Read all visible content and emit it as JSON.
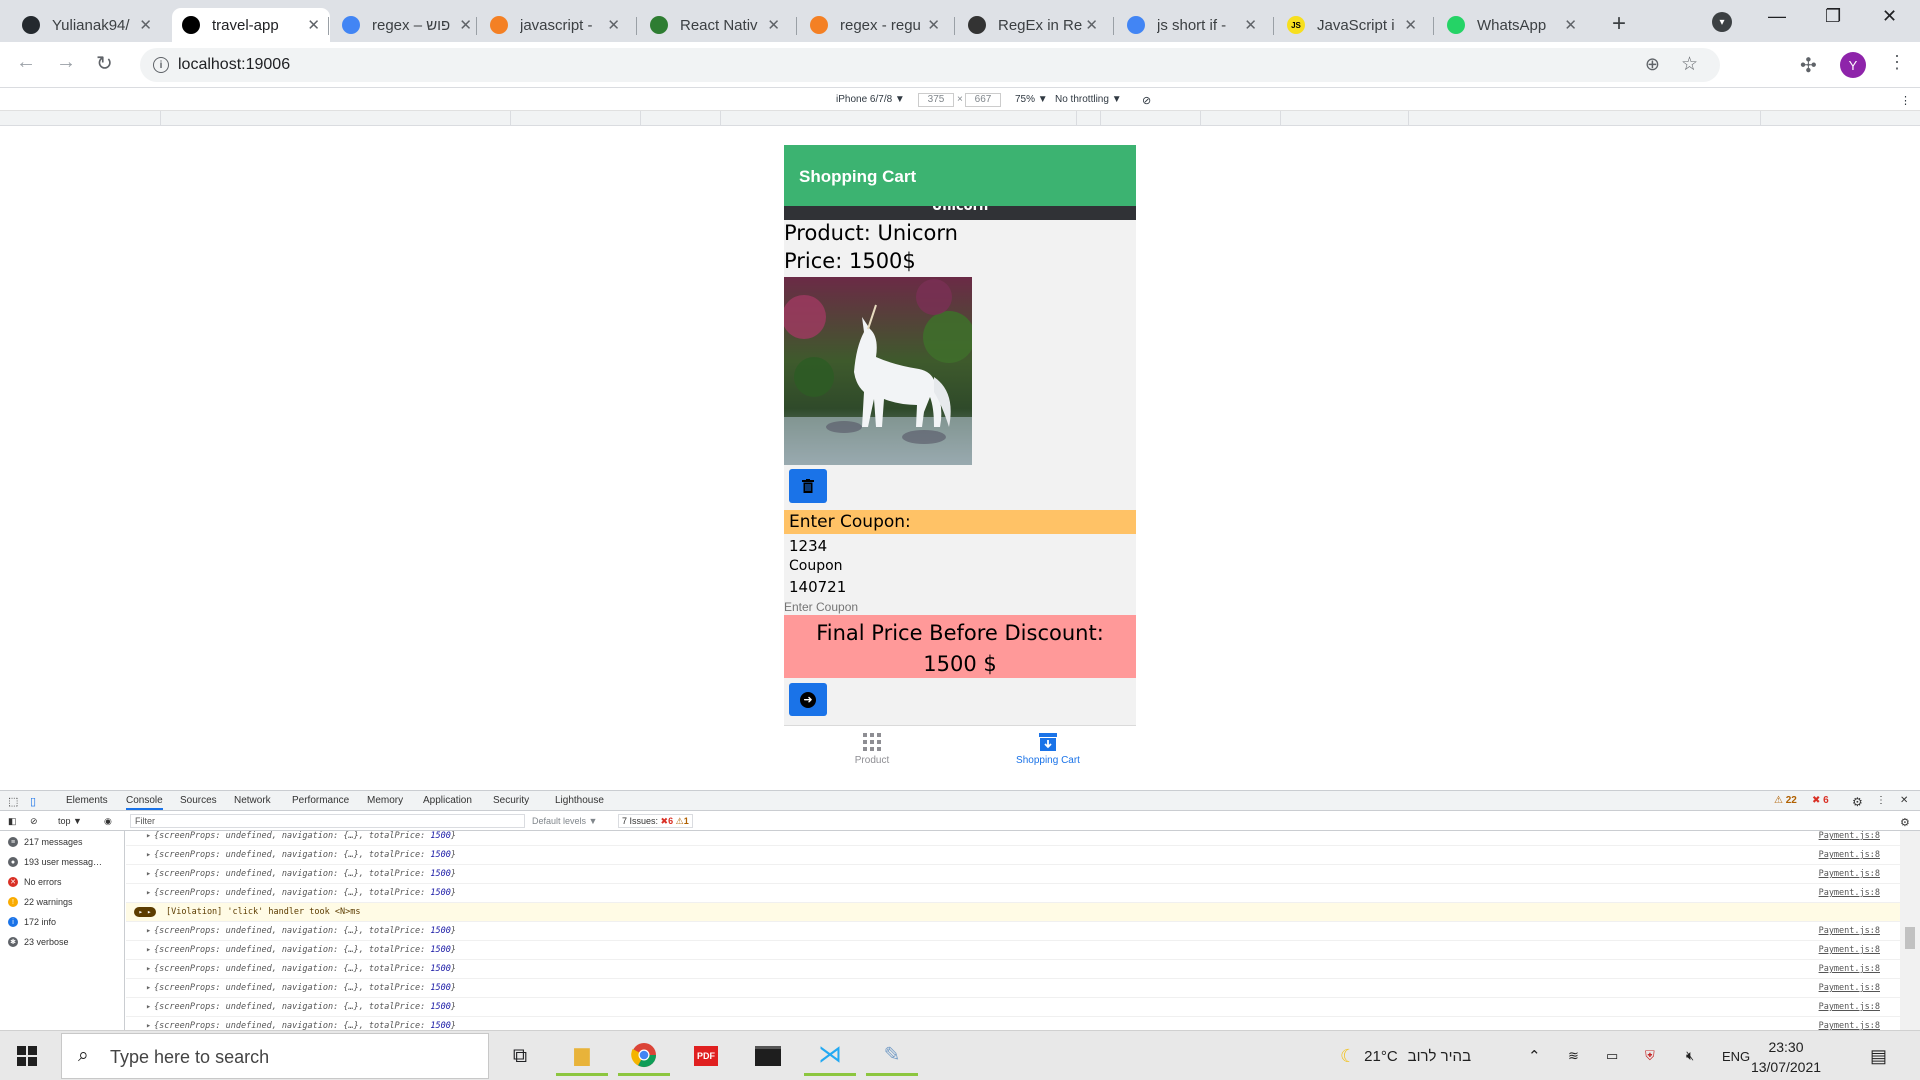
{
  "browser": {
    "tabs": [
      {
        "title": "Yulianak94/",
        "favicon": "github-icon",
        "color": "#24292e"
      },
      {
        "title": "travel-app",
        "favicon": "expo-icon",
        "color": "#000000"
      },
      {
        "title": "regex – פוש",
        "favicon": "google-icon",
        "color": "#4285f4"
      },
      {
        "title": "javascript -",
        "favicon": "stackoverflow-icon",
        "color": "#f48024"
      },
      {
        "title": "React Nativ",
        "favicon": "react-native-icon",
        "color": "#2e7d32"
      },
      {
        "title": "regex - regu",
        "favicon": "stackoverflow-icon",
        "color": "#f48024"
      },
      {
        "title": "RegEx in Re",
        "favicon": "regex-icon",
        "color": "#333333"
      },
      {
        "title": "js short if -",
        "favicon": "google-icon",
        "color": "#4285f4"
      },
      {
        "title": "JavaScript i",
        "favicon": "js-icon",
        "color": "#f7df1e"
      },
      {
        "title": "WhatsApp",
        "favicon": "whatsapp-icon",
        "color": "#25d366"
      }
    ],
    "url": "localhost:19006",
    "profile_initial": "Y"
  },
  "device_toolbar": {
    "device": "iPhone 6/7/8 ▼",
    "width": "375",
    "times": "×",
    "height": "667",
    "zoom": "75% ▼",
    "throttling": "No throttling ▼"
  },
  "app": {
    "header_title": "Shopping Cart",
    "banner_text": "Unicorn",
    "product_line": "Product: Unicorn",
    "price_line": "Price: 1500$",
    "coupon_header": "Enter Coupon:",
    "coupon_code": "1234",
    "coupon_label": "Coupon",
    "coupon_value": "140721",
    "coupon_placeholder": "Enter Coupon",
    "final_title": "Final Price Before Discount:",
    "final_price": "1500 $",
    "tabbar": [
      {
        "label": "Product",
        "icon": "grid-icon",
        "active": false
      },
      {
        "label": "Shopping Cart",
        "icon": "cart-download-icon",
        "active": true
      }
    ],
    "colors": {
      "header": "#3cb371",
      "coupon": "#ffc266",
      "final": "#ff9999",
      "button": "#1a73e8",
      "active_tab": "#1a73e8"
    }
  },
  "devtools": {
    "tabs": [
      "Elements",
      "Console",
      "Sources",
      "Network",
      "Performance",
      "Memory",
      "Application",
      "Security",
      "Lighthouse"
    ],
    "active_tab": "Console",
    "warnings_count": "22",
    "errors_count": "6",
    "context": "top ▼",
    "filter_placeholder": "Filter",
    "levels": "Default levels ▼",
    "issues_label": "7 Issues:",
    "issues_errors": "6",
    "issues_warnings": "1",
    "sidebar": [
      {
        "label": "217 messages",
        "icon": "list-icon",
        "color": "#5f6368"
      },
      {
        "label": "193 user messag…",
        "icon": "user-icon",
        "color": "#5f6368"
      },
      {
        "label": "No errors",
        "icon": "error-icon",
        "color": "#d93025"
      },
      {
        "label": "22 warnings",
        "icon": "warning-icon",
        "color": "#f9ab00"
      },
      {
        "label": "172 info",
        "icon": "info-icon",
        "color": "#1a73e8"
      },
      {
        "label": "23 verbose",
        "icon": "bug-icon",
        "color": "#5f6368"
      }
    ],
    "log_prefix": "{screenProps: undefined, navigation: {…}, totalPrice: ",
    "log_value": "1500",
    "log_suffix": "}",
    "log_source": "Payment.js:8",
    "violation_text": "[Violation] 'click' handler took <N>ms"
  },
  "taskbar": {
    "search_placeholder": "Type here to search",
    "weather": "21°C",
    "weather_text": "בהיר לרוב",
    "lang": "ENG",
    "time": "23:30",
    "date": "13/07/2021"
  }
}
